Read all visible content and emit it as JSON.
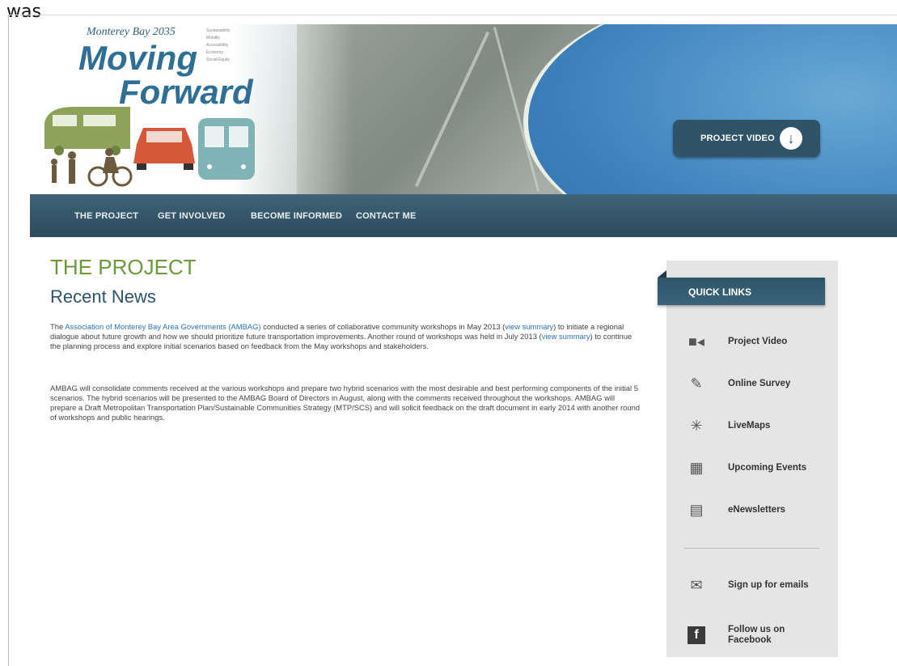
{
  "top_text": "was",
  "banner": {
    "logo_small": "Monterey Bay 2035",
    "logo_line1": "Moving",
    "logo_line2": "Forward",
    "logo_tags": [
      "Sustainability",
      "Mobility",
      "Accessibility",
      "Economy",
      "Social Equity"
    ],
    "video_button": "PROJECT VIDEO",
    "video_icon": "download-arrow-icon"
  },
  "nav": {
    "items": [
      "THE PROJECT",
      "GET INVOLVED",
      "BECOME INFORMED",
      "CONTACT ME"
    ]
  },
  "main": {
    "heading": "THE PROJECT",
    "subheading": "Recent News",
    "p1": {
      "t1": "The ",
      "link1": "Association of Monterey Bay Area Governments (AMBAG)",
      "t2": " conducted a series of collaborative community workshops in May 2013 (",
      "link2": "view summary",
      "t3": ") to initiate a regional dialogue about future growth and how we should prioritize future transportation improvements.  Another round of workshops was held in July 2013 (",
      "link3": "view summary",
      "t4": ") to continue the planning process and explore initial scenarios based on feedback from the May workshops and stakeholders."
    },
    "p2": "AMBAG will consolidate comments received at the various workshops and prepare two hybrid scenarios with the most desirable and best performing components of the initial 5 scenarios. The hybrid scenarios will be presented to the AMBAG Board of Directors in August, along with the comments received throughout the workshops. AMBAG will prepare a Draft Metropolitan Transportation Plan/Sustainable Communities Strategy (MTP/SCS) and will solicit feedback on the draft document in early 2014 with another round of workshops and public hearings."
  },
  "sidebar": {
    "title": "QUICK LINKS",
    "links": [
      {
        "label": "Project Video",
        "icon": "video-camera-icon"
      },
      {
        "label": "Online Survey",
        "icon": "survey-pencil-icon"
      },
      {
        "label": "LiveMaps",
        "icon": "compass-icon"
      },
      {
        "label": "Upcoming Events",
        "icon": "calendar-icon"
      },
      {
        "label": "eNewsletters",
        "icon": "newsletter-icon"
      }
    ],
    "extra_links": [
      {
        "label": "Sign up for emails",
        "icon": "envelope-icon"
      },
      {
        "label": "Follow us on Facebook",
        "icon": "facebook-icon"
      }
    ]
  }
}
